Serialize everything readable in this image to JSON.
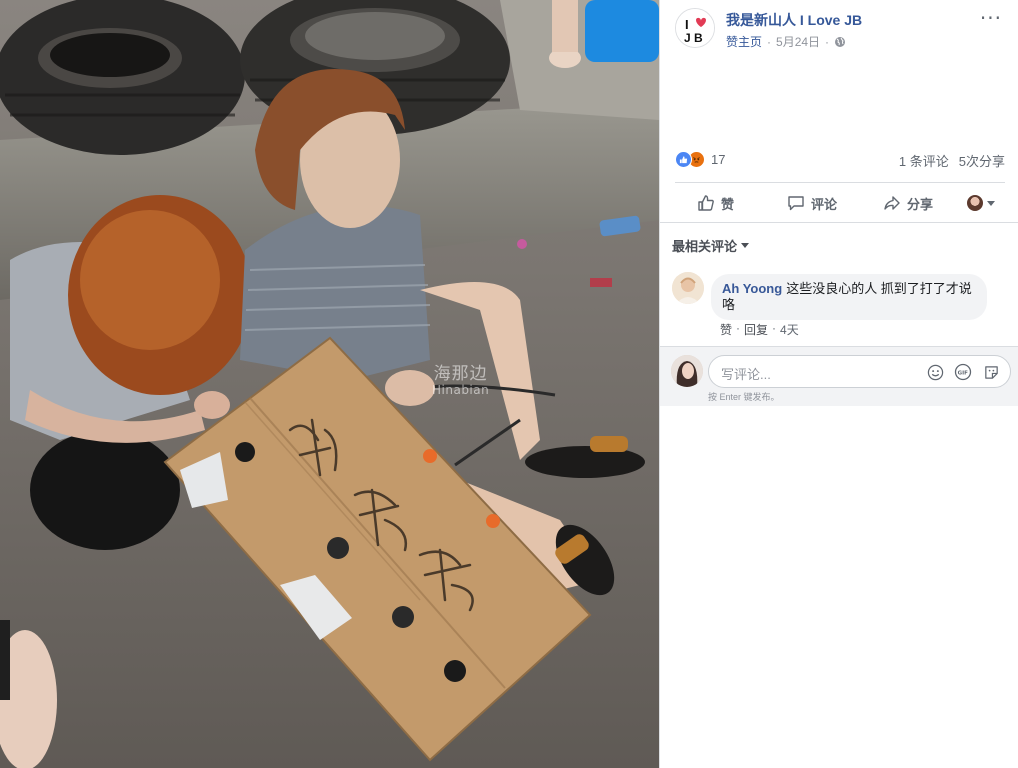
{
  "photo": {
    "watermark_main": "海那边",
    "watermark_sub": "Hinabian",
    "sign_text": [
      "绿",
      "魂",
      "党"
    ]
  },
  "post": {
    "page_name": "我是新山人 I Love JB",
    "avatar_text_top": "I",
    "avatar_text_bottom": "J B",
    "meta_label": "赞主页",
    "date": "5月24日",
    "more_label": "···"
  },
  "stats": {
    "reaction_count": "17",
    "comments": "1 条评论",
    "shares": "5次分享"
  },
  "actions": {
    "like": "赞",
    "comment": "评论",
    "share": "分享"
  },
  "comments_section": {
    "sort_label": "最相关评论",
    "items": [
      {
        "author": "Ah Yoong",
        "text": "这些没良心的人 抓到了打了才说咯",
        "like": "赞",
        "reply": "回复",
        "time": "4天"
      }
    ],
    "placeholder": "写评论...",
    "hint": "按 Enter 键发布。"
  },
  "colors": {
    "link": "#365899",
    "meta": "#90949c",
    "like": "#4b86f4",
    "angry": "#e9710f"
  }
}
